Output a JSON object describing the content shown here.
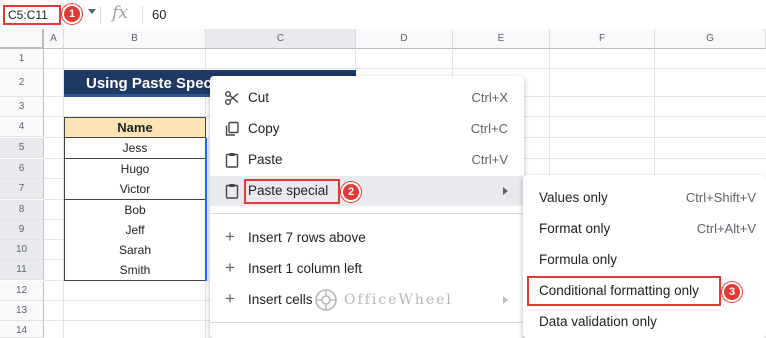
{
  "formula_bar": {
    "name_box": "C5:C11",
    "fx_symbol": "fx",
    "value": "60"
  },
  "callouts": [
    "1",
    "2",
    "3"
  ],
  "columns": [
    "A",
    "B",
    "C",
    "D",
    "E",
    "F",
    "G"
  ],
  "rows": [
    "1",
    "2",
    "3",
    "4",
    "5",
    "6",
    "7",
    "8",
    "9",
    "10",
    "11",
    "12",
    "13",
    "14"
  ],
  "sheet": {
    "title": "Using Paste Special",
    "header": "Name",
    "names": [
      "Jess",
      "Hugo",
      "Victor",
      "Bob",
      "Jeff",
      "Sarah",
      "Smith"
    ]
  },
  "context_menu": {
    "cut": {
      "label": "Cut",
      "shortcut": "Ctrl+X"
    },
    "copy": {
      "label": "Copy",
      "shortcut": "Ctrl+C"
    },
    "paste": {
      "label": "Paste",
      "shortcut": "Ctrl+V"
    },
    "paste_special": {
      "label": "Paste special"
    },
    "insert_rows": {
      "label": "Insert 7 rows above"
    },
    "insert_column": {
      "label": "Insert 1 column left"
    },
    "insert_cells": {
      "label": "Insert cells"
    }
  },
  "submenu": {
    "values_only": {
      "label": "Values only",
      "shortcut": "Ctrl+Shift+V"
    },
    "format_only": {
      "label": "Format only",
      "shortcut": "Ctrl+Alt+V"
    },
    "formula_only": {
      "label": "Formula only"
    },
    "conditional_formatting_only": {
      "label": "Conditional formatting only"
    },
    "data_validation_only": {
      "label": "Data validation only"
    }
  },
  "watermark": "OfficeWheel",
  "colors": {
    "callout": "#e53935",
    "title_bg": "#1f3864",
    "header_bg": "#fce4b4",
    "selection": "#1a73e8"
  }
}
